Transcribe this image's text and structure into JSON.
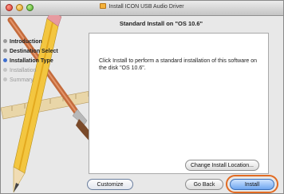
{
  "window": {
    "title": "Install ICON USB Audio Driver",
    "icon": "package-icon"
  },
  "header": {
    "title": "Standard Install on \"OS 10.6\""
  },
  "sidebar": {
    "steps": [
      {
        "label": "Introduction",
        "state": "done"
      },
      {
        "label": "Destination Select",
        "state": "done"
      },
      {
        "label": "Installation Type",
        "state": "current"
      },
      {
        "label": "Installation",
        "state": "pending"
      },
      {
        "label": "Summary",
        "state": "pending"
      }
    ]
  },
  "content": {
    "message": "Click Install to perform a standard installation of this software on the disk \"OS 10.6\"."
  },
  "buttons": {
    "change_location": "Change Install Location...",
    "customize": "Customize",
    "go_back": "Go Back",
    "install": "Install"
  },
  "colors": {
    "highlight": "#e26b22",
    "current_step": "#3f6fd0",
    "default_button": "#6fa6ef"
  }
}
